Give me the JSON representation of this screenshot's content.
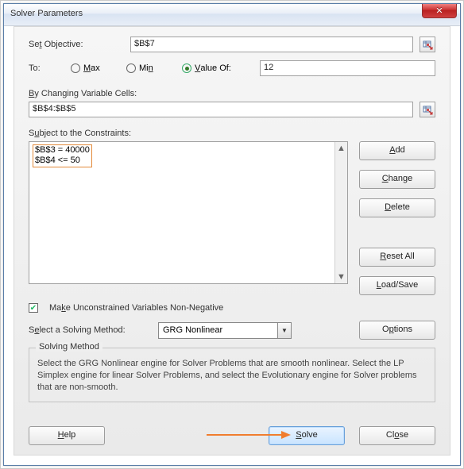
{
  "window": {
    "title": "Solver Parameters",
    "close_glyph": "✕"
  },
  "objective": {
    "label_pre": "Se",
    "label_und": "t",
    "label_post": " Objective:",
    "value": "$B$7"
  },
  "to": {
    "label": "To:",
    "max_und": "M",
    "max_post": "ax",
    "min_pre": "Mi",
    "min_und": "n",
    "valueof_und": "V",
    "valueof_post": "alue Of:",
    "selected": "value",
    "value": "12"
  },
  "changing": {
    "label_und": "B",
    "label_post": "y Changing Variable Cells:",
    "value": "$B$4:$B$5"
  },
  "constraints": {
    "label_pre": "S",
    "label_und": "u",
    "label_post": "bject to the Constraints:",
    "items": [
      "$B$3 = 40000",
      "$B$4 <= 50"
    ]
  },
  "buttons": {
    "add_und": "A",
    "add_post": "dd",
    "change_und": "C",
    "change_post": "hange",
    "delete_und": "D",
    "delete_post": "elete",
    "reset_und": "R",
    "reset_post": "eset All",
    "load_und": "L",
    "load_post": "oad/Save",
    "options_pre": "O",
    "options_und": "p",
    "options_post": "tions"
  },
  "nonneg": {
    "checked": true,
    "label_pre": "Ma",
    "label_und": "k",
    "label_post": "e Unconstrained Variables Non-Negative"
  },
  "method": {
    "label_pre": "S",
    "label_und": "e",
    "label_post": "lect a Solving Method:",
    "value": "GRG Nonlinear"
  },
  "groupbox": {
    "title": "Solving Method",
    "desc": "Select the GRG Nonlinear engine for Solver Problems that are smooth nonlinear. Select the LP Simplex engine for linear Solver Problems, and select the Evolutionary engine for Solver problems that are non-smooth."
  },
  "footer": {
    "help_und": "H",
    "help_post": "elp",
    "solve_und": "S",
    "solve_post": "olve",
    "close_pre": "Cl",
    "close_und": "o",
    "close_post": "se"
  }
}
